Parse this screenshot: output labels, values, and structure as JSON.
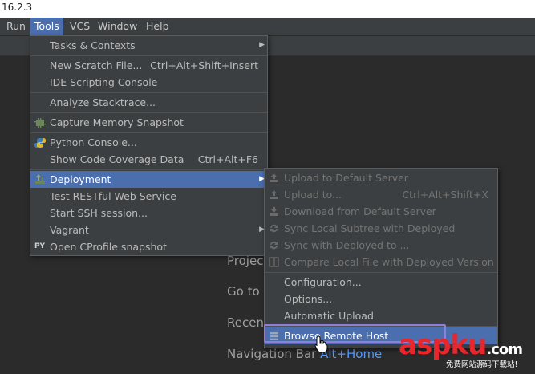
{
  "title": "16.2.3",
  "menubar": [
    {
      "label": "Run",
      "active": false
    },
    {
      "label": "Tools",
      "active": true
    },
    {
      "label": "VCS",
      "active": false
    },
    {
      "label": "Window",
      "active": false
    },
    {
      "label": "Help",
      "active": false
    }
  ],
  "tools_menu": {
    "items": [
      {
        "label": "Tasks & Contexts",
        "shortcut": "",
        "submenu": true,
        "icon": ""
      },
      {
        "label": "New Scratch File...",
        "shortcut": "Ctrl+Alt+Shift+Insert",
        "icon": ""
      },
      {
        "label": "IDE Scripting Console",
        "shortcut": "",
        "icon": ""
      },
      {
        "label": "Analyze Stacktrace...",
        "shortcut": "",
        "icon": ""
      },
      {
        "label": "Capture Memory Snapshot",
        "shortcut": "",
        "icon": "memory-icon"
      },
      {
        "label": "Python Console...",
        "shortcut": "",
        "icon": "python-icon"
      },
      {
        "label": "Show Code Coverage Data",
        "shortcut": "Ctrl+Alt+F6",
        "icon": ""
      },
      {
        "label": "Deployment",
        "shortcut": "",
        "submenu": true,
        "selected": true,
        "icon": "deployment-icon"
      },
      {
        "label": "Test RESTful Web Service",
        "shortcut": "",
        "icon": ""
      },
      {
        "label": "Start SSH session...",
        "shortcut": "",
        "icon": ""
      },
      {
        "label": "Vagrant",
        "shortcut": "",
        "submenu": true,
        "icon": ""
      },
      {
        "label": "Open CProfile snapshot",
        "shortcut": "",
        "icon": "python-profile-icon"
      }
    ],
    "python_profile_icon_text": "PY"
  },
  "deployment_menu": {
    "items": [
      {
        "label": "Upload to Default Server",
        "shortcut": "",
        "disabled": true,
        "icon": "upload-icon"
      },
      {
        "label": "Upload to...",
        "shortcut": "Ctrl+Alt+Shift+X",
        "disabled": true,
        "icon": "upload-icon"
      },
      {
        "label": "Download from Default Server",
        "shortcut": "",
        "disabled": true,
        "icon": "download-icon"
      },
      {
        "label": "Sync Local Subtree with Deployed",
        "shortcut": "",
        "disabled": true,
        "icon": "sync-icon"
      },
      {
        "label": "Sync with Deployed to ...",
        "shortcut": "",
        "disabled": true,
        "icon": "sync-icon"
      },
      {
        "label": "Compare Local File with Deployed Version",
        "shortcut": "",
        "disabled": true,
        "icon": "compare-icon"
      },
      {
        "label": "Configuration...",
        "shortcut": "",
        "disabled": false,
        "icon": ""
      },
      {
        "label": "Options...",
        "shortcut": "",
        "disabled": false,
        "icon": ""
      },
      {
        "label": "Automatic Upload",
        "shortcut": "",
        "disabled": false,
        "icon": ""
      },
      {
        "label": "Browse Remote Host",
        "shortcut": "",
        "disabled": false,
        "selected": true,
        "icon": "remote-host-icon"
      }
    ]
  },
  "editor_hints": {
    "project": "Projec",
    "goto": "Go to",
    "recent": "Recen",
    "navbar_label": "Navigation Bar",
    "navbar_key": "Alt+Home"
  },
  "watermark": {
    "part1": "asp",
    "part2": "ku",
    "part3": ".com",
    "tagline": "免费网站源码下载站!"
  },
  "colors": {
    "selection": "#4b6eaf",
    "menu_bg": "#3c3f41",
    "editor_bg": "#2b2b2b",
    "highlight_box": "#8f7fd9",
    "watermark_red": "#e8262c"
  }
}
